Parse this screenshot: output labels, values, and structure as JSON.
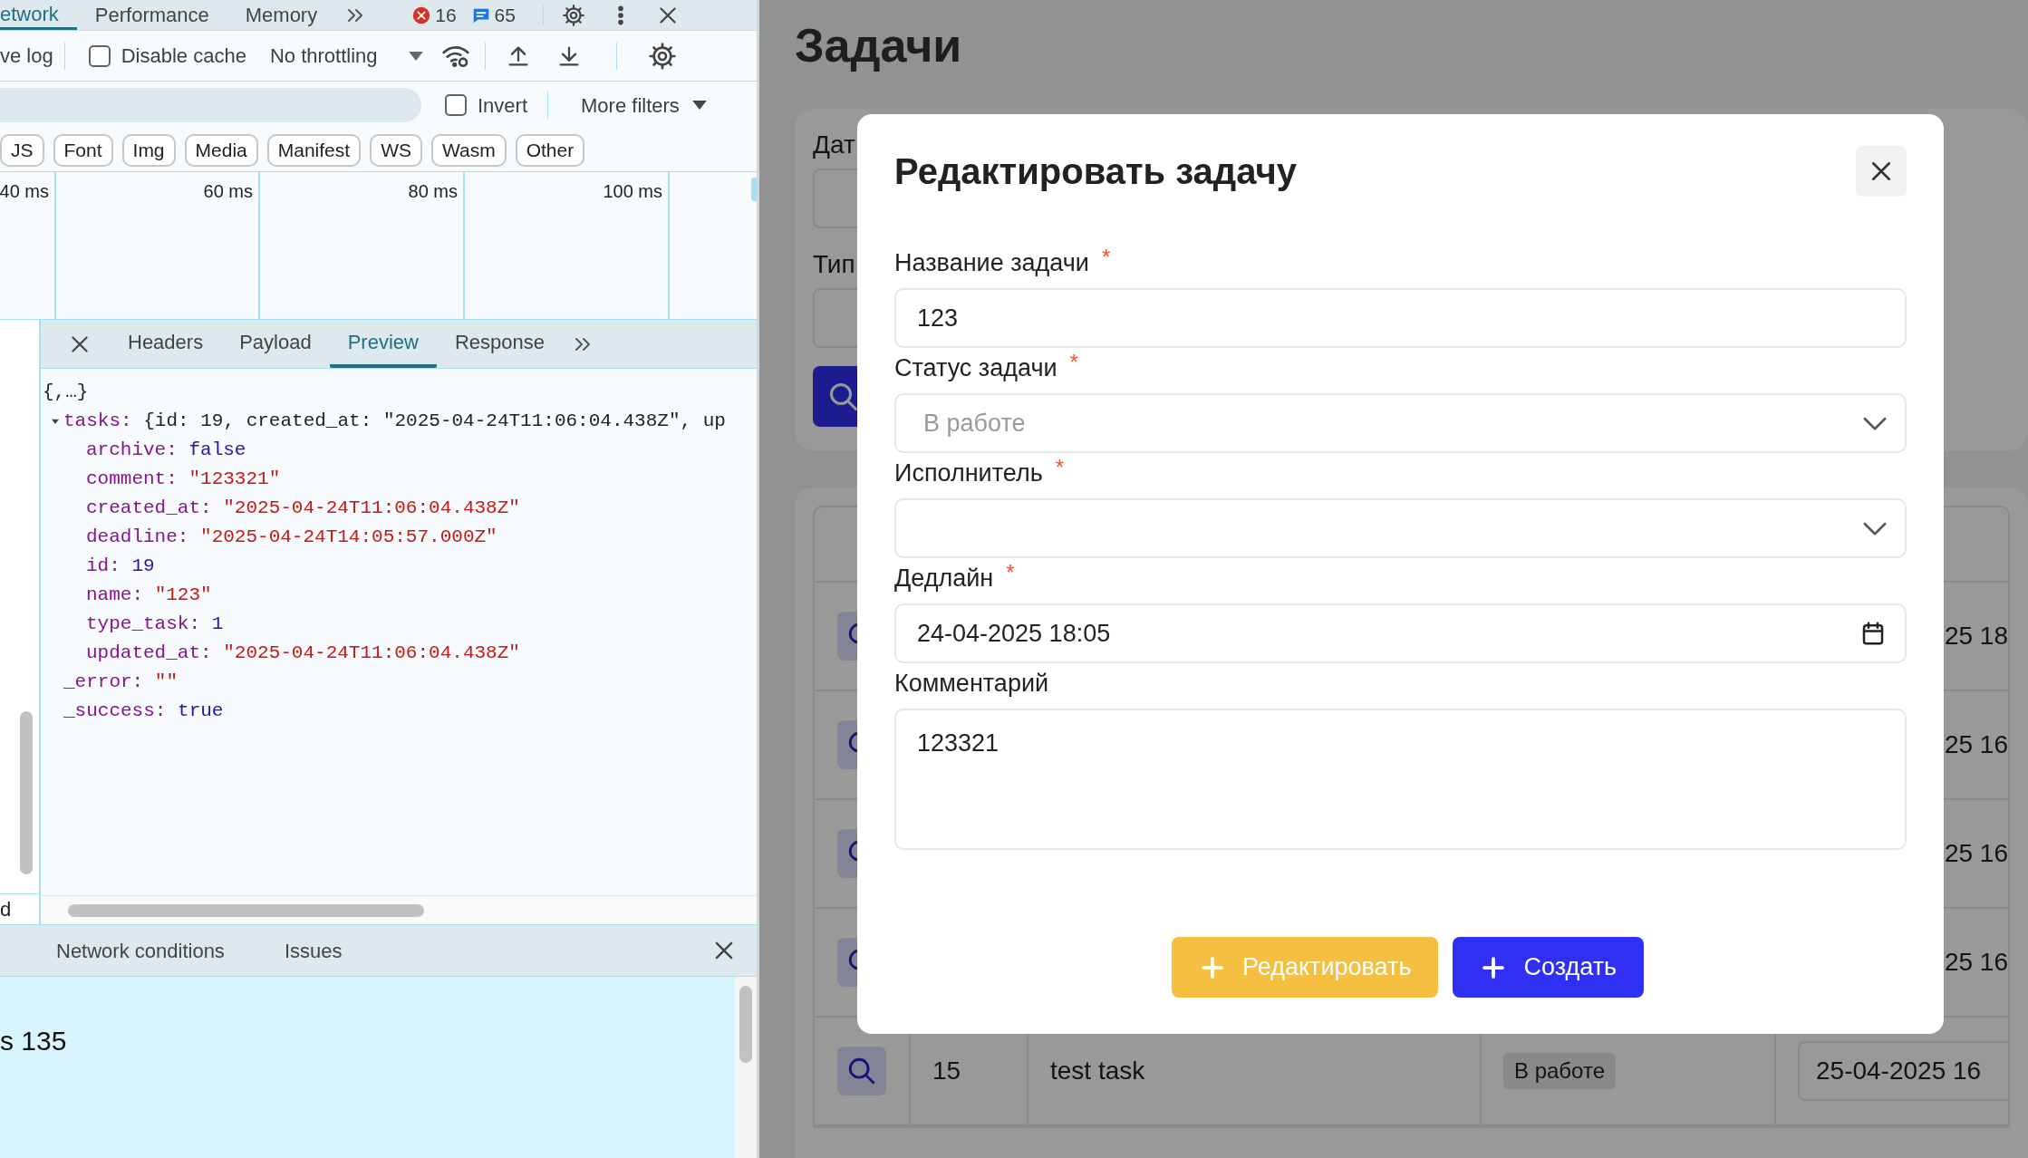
{
  "devtools": {
    "main_tabs": [
      {
        "label": "etwork",
        "selected": true
      },
      {
        "label": "Performance",
        "selected": false
      },
      {
        "label": "Memory",
        "selected": false
      }
    ],
    "error_count": "16",
    "message_count": "65",
    "toolbar": {
      "preserve_log": "ve log",
      "disable_cache": {
        "label": "Disable cache",
        "checked": false
      },
      "throttling": "No throttling"
    },
    "filter": {
      "invert": {
        "label": "Invert",
        "checked": false
      },
      "more_filters": "More filters"
    },
    "type_filters": [
      "JS",
      "Font",
      "Img",
      "Media",
      "Manifest",
      "WS",
      "Wasm",
      "Other"
    ],
    "timeline_ticks": [
      "40 ms",
      "60 ms",
      "80 ms",
      "100 ms"
    ],
    "request_list_fragment": "d",
    "detail_tabs": [
      {
        "label": "Headers",
        "selected": false
      },
      {
        "label": "Payload",
        "selected": false
      },
      {
        "label": "Preview",
        "selected": true
      },
      {
        "label": "Response",
        "selected": false
      }
    ],
    "preview": {
      "summary": "{,…}",
      "properties": [
        {
          "key": "tasks:",
          "value": "{id: 19, created_at: \"2025-04-24T11:06:04.438Z\", up",
          "kind": "object",
          "expanded": true,
          "children": [
            {
              "key": "archive:",
              "value": "false",
              "kind": "boolean"
            },
            {
              "key": "comment:",
              "value": "\"123321\"",
              "kind": "string"
            },
            {
              "key": "created_at:",
              "value": "\"2025-04-24T11:06:04.438Z\"",
              "kind": "string"
            },
            {
              "key": "deadline:",
              "value": "\"2025-04-24T14:05:57.000Z\"",
              "kind": "string"
            },
            {
              "key": "id:",
              "value": "19",
              "kind": "number"
            },
            {
              "key": "name:",
              "value": "\"123\"",
              "kind": "string"
            },
            {
              "key": "type_task:",
              "value": "1",
              "kind": "number"
            },
            {
              "key": "updated_at:",
              "value": "\"2025-04-24T11:06:04.438Z\"",
              "kind": "string"
            }
          ]
        },
        {
          "key": "_error:",
          "value": "\"\"",
          "kind": "string"
        },
        {
          "key": "_success:",
          "value": "true",
          "kind": "boolean"
        }
      ]
    },
    "drawer_tabs": [
      "Network conditions",
      "Issues"
    ],
    "drawer_text": "s 135"
  },
  "page": {
    "title": "Задачи",
    "filter_labels": [
      "Дат",
      "Тип"
    ],
    "rows": [
      {
        "kind": "covered",
        "date_fragment": "25 18"
      },
      {
        "kind": "covered",
        "date_fragment": "25 16"
      },
      {
        "kind": "covered",
        "date_fragment": "25 16"
      },
      {
        "kind": "covered",
        "date_fragment": "25 16"
      },
      {
        "kind": "full",
        "id": "15",
        "name": "test task",
        "status": "В работе",
        "date": "25-04-2025 16"
      }
    ]
  },
  "modal": {
    "title": "Редактировать задачу",
    "fields": [
      {
        "kind": "text",
        "label": "Название задачи",
        "required_mark": "*",
        "value": "123"
      },
      {
        "kind": "select",
        "label": "Статус задачи",
        "required_mark": "*",
        "disabled": true,
        "value": "В работе"
      },
      {
        "kind": "select",
        "label": "Исполнитель",
        "required_mark": "*"
      },
      {
        "kind": "date",
        "label": "Дедлайн",
        "required_mark": "*",
        "value": "24-04-2025 18:05"
      },
      {
        "kind": "textarea",
        "label": "Комментарий",
        "value": "123321"
      }
    ],
    "buttons": [
      {
        "kind": "edit",
        "label": "Редактировать"
      },
      {
        "kind": "create",
        "label": "Создать"
      }
    ]
  }
}
